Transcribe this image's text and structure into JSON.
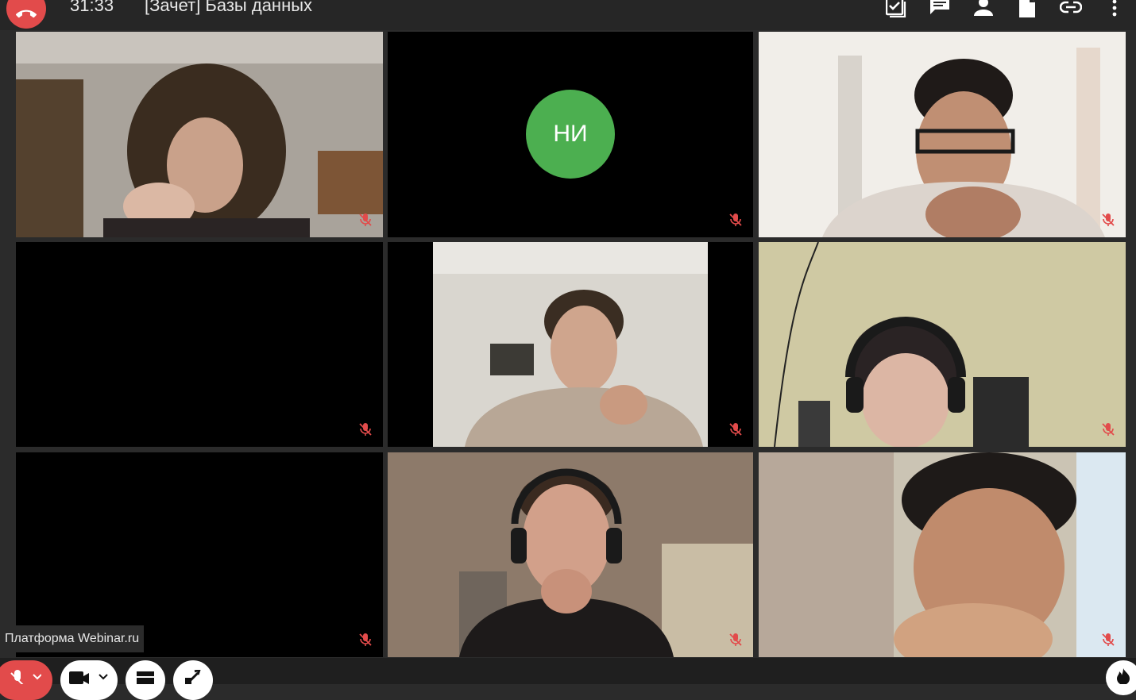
{
  "header": {
    "timer": "31:33",
    "title": "[Зачет] Базы данных",
    "icons": [
      "hangup-icon",
      "tasks-icon",
      "chat-icon",
      "participants-icon",
      "file-icon",
      "link-icon",
      "more-vertical-icon"
    ]
  },
  "tiles": [
    {
      "kind": "video",
      "muted": true
    },
    {
      "kind": "avatar",
      "initials": "НИ",
      "avatar_color": "#4caf50",
      "muted": true
    },
    {
      "kind": "video",
      "muted": true
    },
    {
      "kind": "blank",
      "muted": true
    },
    {
      "kind": "video",
      "muted": true
    },
    {
      "kind": "video",
      "muted": true
    },
    {
      "kind": "blank",
      "muted": true
    },
    {
      "kind": "video",
      "muted": true
    },
    {
      "kind": "video",
      "muted": true
    }
  ],
  "footer": {
    "platform_label": "Платформа Webinar.ru",
    "buttons": [
      "mic-muted-icon",
      "camera-icon",
      "layout-icon",
      "screen-share-icon",
      "flame-icon"
    ]
  },
  "colors": {
    "accent_red": "#e24b4b",
    "avatar_green": "#4caf50",
    "tile_bg": "#000000",
    "bar_bg": "#262626"
  }
}
